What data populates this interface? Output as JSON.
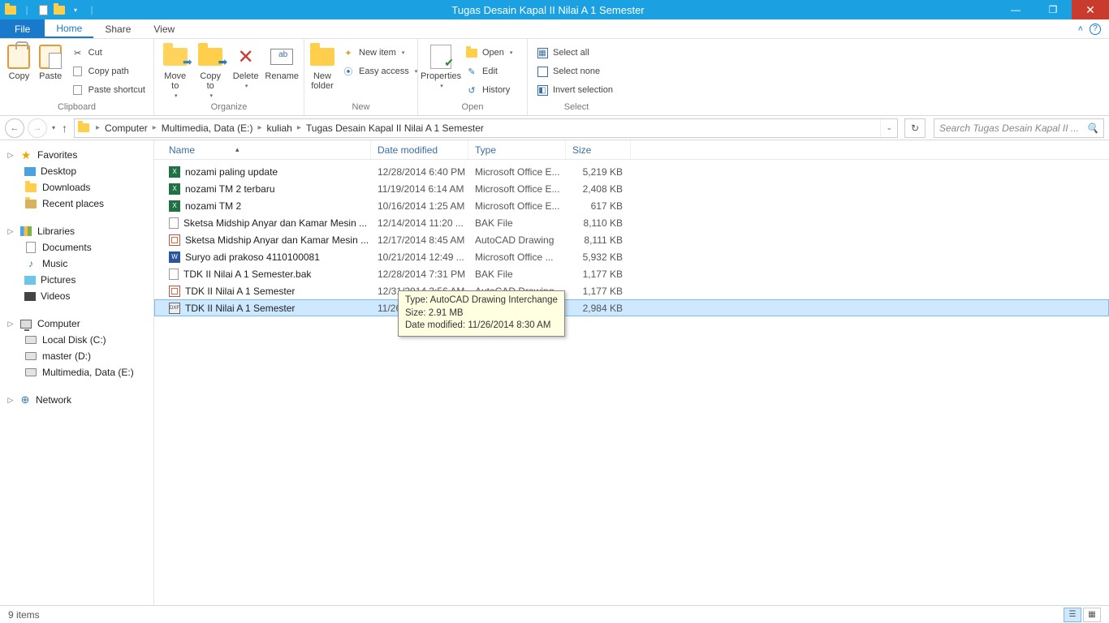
{
  "window": {
    "title": "Tugas Desain  Kapal II Nilai A 1 Semester"
  },
  "tabs": {
    "file": "File",
    "home": "Home",
    "share": "Share",
    "view": "View"
  },
  "ribbon": {
    "clipboard": {
      "label": "Clipboard",
      "copy": "Copy",
      "paste": "Paste",
      "cut": "Cut",
      "copy_path": "Copy path",
      "paste_shortcut": "Paste shortcut"
    },
    "organize": {
      "label": "Organize",
      "move_to": "Move\nto",
      "copy_to": "Copy\nto",
      "delete": "Delete",
      "rename": "Rename"
    },
    "new": {
      "label": "New",
      "new_folder": "New\nfolder",
      "new_item": "New item",
      "easy_access": "Easy access"
    },
    "open": {
      "label": "Open",
      "properties": "Properties",
      "open": "Open",
      "edit": "Edit",
      "history": "History"
    },
    "select": {
      "label": "Select",
      "select_all": "Select all",
      "select_none": "Select none",
      "invert": "Invert selection"
    }
  },
  "breadcrumb": [
    "Computer",
    "Multimedia, Data (E:)",
    "kuliah",
    "Tugas Desain  Kapal II Nilai A 1 Semester"
  ],
  "search_placeholder": "Search Tugas Desain  Kapal II ...",
  "nav": {
    "favorites": "Favorites",
    "desktop": "Desktop",
    "downloads": "Downloads",
    "recent": "Recent places",
    "libraries": "Libraries",
    "documents": "Documents",
    "music": "Music",
    "pictures": "Pictures",
    "videos": "Videos",
    "computer": "Computer",
    "local_c": "Local Disk (C:)",
    "master_d": "master (D:)",
    "multimedia_e": "Multimedia, Data (E:)",
    "network": "Network"
  },
  "columns": {
    "name": "Name",
    "date": "Date modified",
    "type": "Type",
    "size": "Size"
  },
  "files": [
    {
      "icon": "xls",
      "name": "nozami paling update",
      "date": "12/28/2014 6:40 PM",
      "type": "Microsoft Office E...",
      "size": "5,219 KB"
    },
    {
      "icon": "xls",
      "name": "nozami TM 2 terbaru",
      "date": "11/19/2014 6:14 AM",
      "type": "Microsoft Office E...",
      "size": "2,408 KB"
    },
    {
      "icon": "xls",
      "name": "nozami TM 2",
      "date": "10/16/2014 1:25 AM",
      "type": "Microsoft Office E...",
      "size": "617 KB"
    },
    {
      "icon": "page",
      "name": "Sketsa Midship Anyar dan Kamar Mesin  ...",
      "date": "12/14/2014 11:20 ...",
      "type": "BAK File",
      "size": "8,110 KB"
    },
    {
      "icon": "dwg",
      "name": "Sketsa Midship Anyar dan Kamar Mesin  ...",
      "date": "12/17/2014 8:45 AM",
      "type": "AutoCAD Drawing",
      "size": "8,111 KB"
    },
    {
      "icon": "word",
      "name": "Suryo adi prakoso 4110100081",
      "date": "10/21/2014 12:49 ...",
      "type": "Microsoft Office ...",
      "size": "5,932 KB"
    },
    {
      "icon": "page",
      "name": "TDK II Nilai A 1 Semester.bak",
      "date": "12/28/2014 7:31 PM",
      "type": "BAK File",
      "size": "1,177 KB"
    },
    {
      "icon": "dwg",
      "name": "TDK II Nilai A 1 Semester",
      "date": "12/31/2014 3:56 AM",
      "type": "AutoCAD Drawing",
      "size": "1,177 KB"
    },
    {
      "icon": "dxf",
      "name": "TDK II Nilai A 1 Semester",
      "date": "11/26/2014 8:30 AM",
      "type": "AutoCAD Drawing...",
      "size": "2,984 KB",
      "selected": true
    }
  ],
  "tooltip": {
    "l1": "Type: AutoCAD Drawing Interchange",
    "l2": "Size: 2.91 MB",
    "l3": "Date modified: 11/26/2014 8:30 AM"
  },
  "status": {
    "items": "9 items"
  }
}
